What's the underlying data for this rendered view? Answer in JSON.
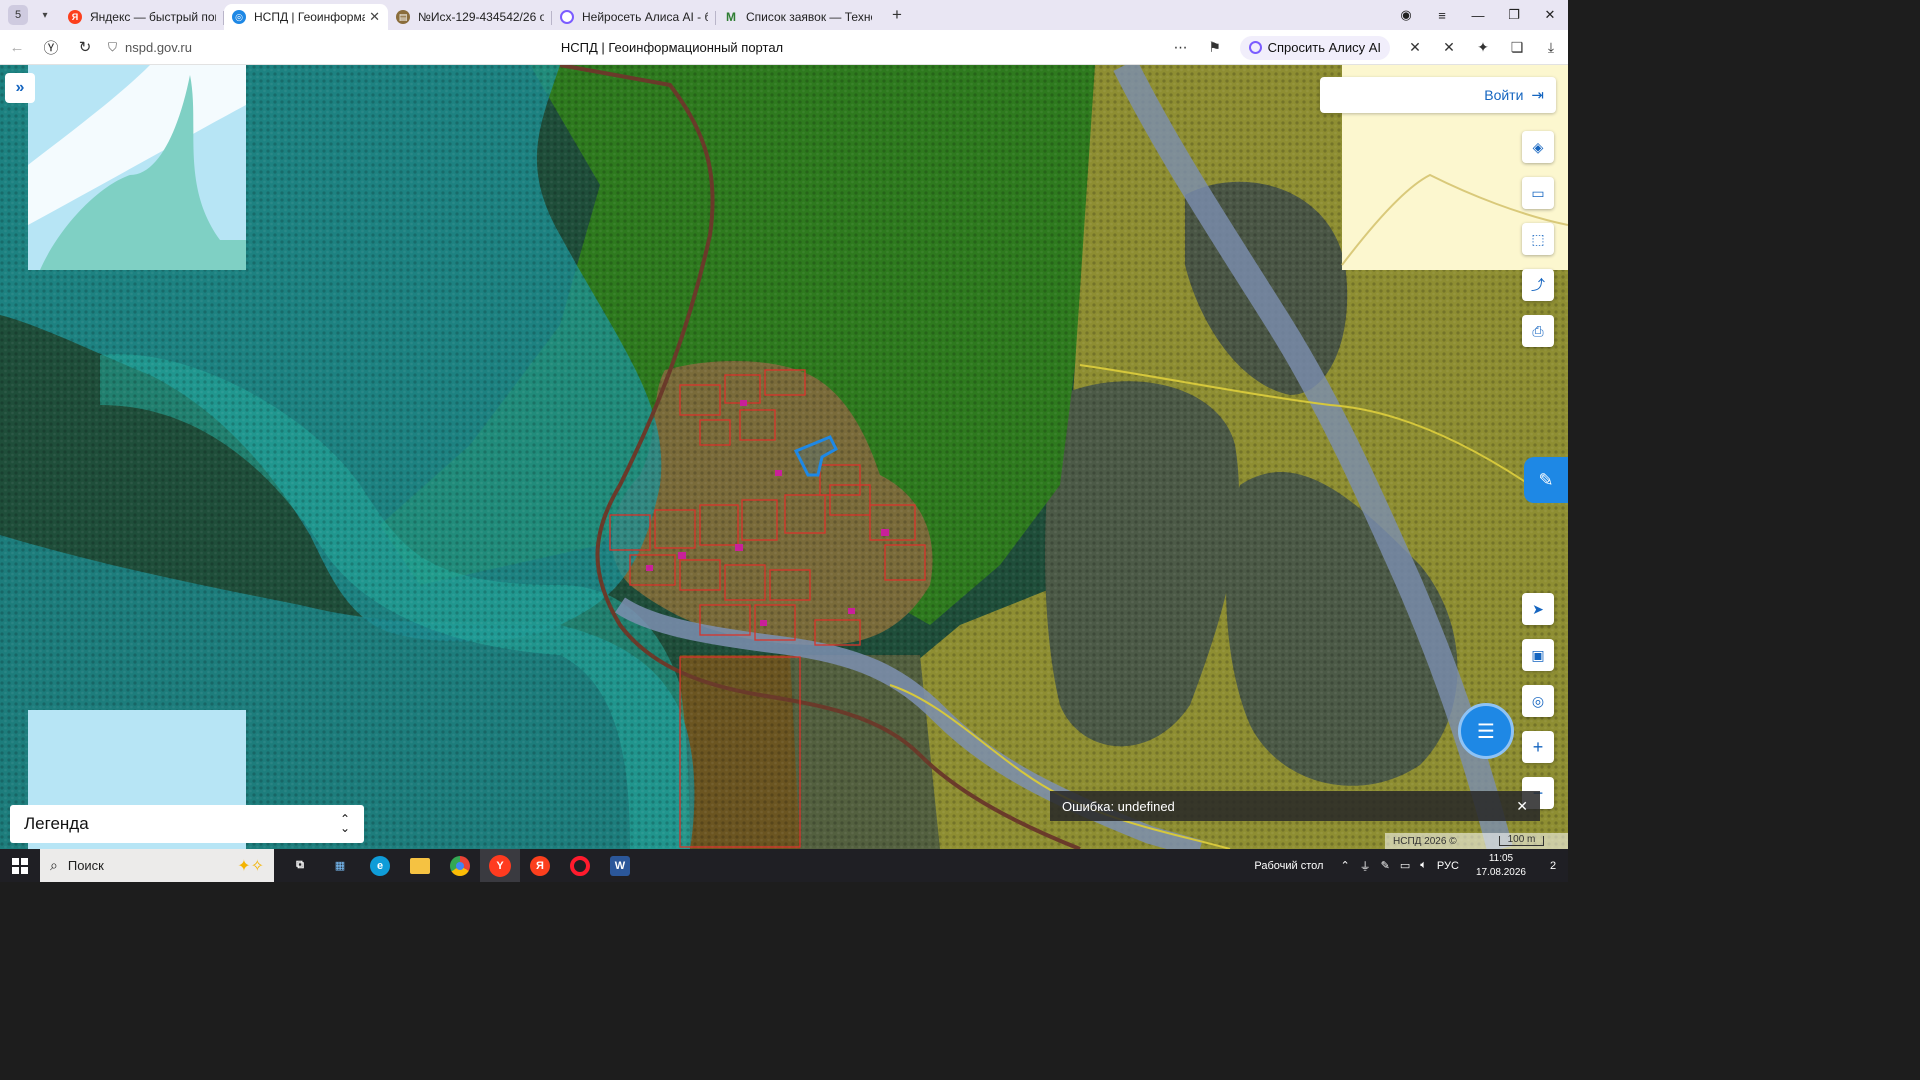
{
  "browser": {
    "tab_count": "5",
    "tabs": [
      {
        "title": "Яндекс — быстрый поиск",
        "favicon": "yandex-icon",
        "color": "#fc3f1d"
      },
      {
        "title": "НСПД | Геоинформаци",
        "favicon": "nspd-icon",
        "color": "#1e88e5",
        "active": true
      },
      {
        "title": "№Исх-129-434542/26 от",
        "favicon": "document-icon",
        "color": "#8a6d3b"
      },
      {
        "title": "Нейросеть Алиса AI - бес",
        "favicon": "alice-icon",
        "color": "#7b5cff"
      },
      {
        "title": "Список заявок — ТехноК",
        "favicon": "gmail-icon",
        "color": "#2e7d32"
      }
    ],
    "url": "nspd.gov.ru",
    "page_title": "НСПД | Геоинформационный портал",
    "ask_alice": "Спросить Алису AI"
  },
  "map": {
    "login_label": "Войти",
    "legend_label": "Легенда",
    "error_text": "Ошибка: undefined",
    "attribution": "НСПД 2026 ©",
    "scale_label": "100 m",
    "colors": {
      "forest_dark": "#1e4d36",
      "forest_green": "#2c7d1c",
      "field_yellow": "#9a9a2a",
      "water_zone": "#2aa3a0",
      "parcel_red": "#d9332b",
      "selected_blue": "#1e88e5",
      "ui_blue": "#1565c0"
    }
  },
  "taskbar": {
    "search_label": "Поиск",
    "desktop_label": "Рабочий стол",
    "language": "РУС",
    "time": "11:05",
    "date": "17.08.2026",
    "notifications": "2"
  }
}
